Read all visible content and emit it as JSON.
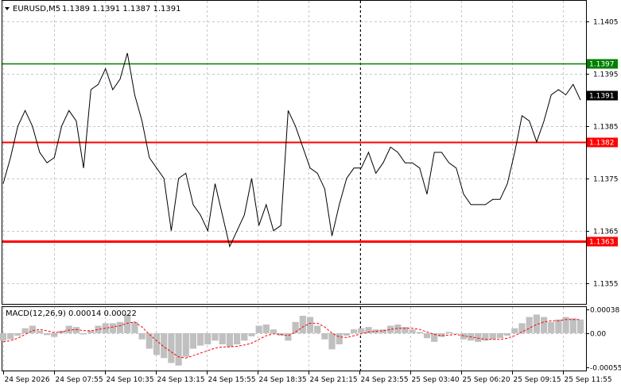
{
  "header": {
    "symbol_label": "EURUSD,M5",
    "ohlc": "1.1389 1.1391 1.1387 1.1391"
  },
  "indicator": {
    "label": "MACD(12,26,9)",
    "values": "0.00014 0.00022"
  },
  "colors": {
    "price_line": "#000000",
    "support_resistance": "#ff0000",
    "target_line": "#008000",
    "current_price_tag": "#000000",
    "macd_histogram": "#c0c0c0",
    "macd_signal": "#ff0000",
    "grid": "#c8c8c8"
  },
  "chart_data": [
    {
      "type": "line",
      "title": "EURUSD,M5",
      "x_tick_labels": [
        "24 Sep 2026",
        "24 Sep 07:55",
        "24 Sep 10:35",
        "24 Sep 13:15",
        "24 Sep 15:55",
        "24 Sep 18:35",
        "24 Sep 21:15",
        "24 Sep 23:55",
        "25 Sep 03:40",
        "25 Sep 06:20",
        "25 Sep 09:15",
        "25 Sep 11:55"
      ],
      "y_tick_labels": [
        "1.1405",
        "1.1395",
        "1.1385",
        "1.1375",
        "1.1365",
        "1.1355"
      ],
      "ylim": [
        1.1351,
        1.1409
      ],
      "y_ticks": [
        1.1405,
        1.1395,
        1.1385,
        1.1375,
        1.1365,
        1.1355
      ],
      "horizontal_lines": [
        {
          "label": "1.1397",
          "value": 1.1397,
          "color": "#008000"
        },
        {
          "label": "1.1382",
          "value": 1.1382,
          "color": "#ff0000"
        },
        {
          "label": "1.1363",
          "value": 1.1363,
          "color": "#ff0000"
        }
      ],
      "current_price": {
        "label": "1.1391",
        "value": 1.1391
      },
      "separator_at_index": 11.0,
      "grid": true,
      "series": [
        {
          "values": [
            1.1374,
            1.1379,
            1.1385,
            1.1388,
            1.1385,
            1.138,
            1.1378,
            1.1379,
            1.1385,
            1.1388,
            1.1386,
            1.1377,
            1.1392,
            1.1393,
            1.1396,
            1.1392,
            1.1394,
            1.1399,
            1.1391,
            1.1386,
            1.1379,
            1.1377,
            1.1375,
            1.1365,
            1.1375,
            1.1376,
            1.137,
            1.1368,
            1.1365,
            1.1374,
            1.1368,
            1.1362,
            1.1365,
            1.1368,
            1.1375,
            1.1366,
            1.137,
            1.1365,
            1.1366,
            1.1388,
            1.1385,
            1.1381,
            1.1377,
            1.1376,
            1.1373,
            1.1364,
            1.137,
            1.1375,
            1.1377,
            1.1377,
            1.138,
            1.1376,
            1.1378,
            1.1381,
            1.138,
            1.1378,
            1.1378,
            1.1377,
            1.1372,
            1.138,
            1.138,
            1.1378,
            1.1377,
            1.1372,
            1.137,
            1.137,
            1.137,
            1.1371,
            1.1371,
            1.1374,
            1.138,
            1.1387,
            1.1386,
            1.1382,
            1.1386,
            1.1391,
            1.1392,
            1.1391,
            1.1393,
            1.139
          ]
        }
      ]
    },
    {
      "type": "bar",
      "title": "MACD(12,26,9)",
      "y_tick_labels": [
        "0.00038",
        "0.00",
        "-0.00055"
      ],
      "ylim": [
        -0.0006,
        0.00042
      ],
      "y_ticks": [
        0.00038,
        0.0,
        -0.00055
      ],
      "series": [
        {
          "name": "MACD",
          "values": [
            -0.00012,
            -0.0001,
            -4e-05,
            8e-05,
            0.00012,
            4e-05,
            -3e-05,
            -6e-05,
            4e-05,
            0.00012,
            0.0001,
            -2e-05,
            4e-05,
            0.00012,
            0.00016,
            0.00016,
            0.00018,
            0.0003,
            0.00018,
            -0.0001,
            -0.00025,
            -0.00035,
            -0.0004,
            -0.00048,
            -0.00052,
            -0.00038,
            -0.00025,
            -0.0002,
            -0.00018,
            -0.00012,
            -0.00018,
            -0.00022,
            -0.00018,
            -0.00012,
            -5e-05,
            0.00012,
            0.00014,
            6e-05,
            -4e-05,
            -0.00012,
            0.00018,
            0.00028,
            0.00026,
            0.00012,
            -0.0001,
            -0.00026,
            -0.00018,
            -4e-05,
            6e-05,
            8e-05,
            0.0001,
            6e-05,
            6e-05,
            0.00012,
            0.00014,
            0.0001,
            6e-05,
            2e-05,
            -8e-05,
            -0.00014,
            -6e-05,
            2e-05,
            0.0,
            -0.0001,
            -0.00012,
            -0.00014,
            -0.00012,
            -0.0001,
            -8e-05,
            -4e-05,
            8e-05,
            0.00016,
            0.00026,
            0.0003,
            0.00026,
            0.00018,
            0.00022,
            0.00026,
            0.00024,
            0.00022
          ]
        },
        {
          "name": "Signal",
          "values": [
            -0.00014,
            -0.00012,
            -8e-05,
            -2e-05,
            4e-05,
            6e-05,
            4e-05,
            1e-05,
            2e-05,
            5e-05,
            6e-05,
            4e-05,
            4e-05,
            6e-05,
            8e-05,
            0.0001,
            0.00012,
            0.00016,
            0.00018,
            0.0001,
            -2e-05,
            -0.00012,
            -0.00022,
            -0.0003,
            -0.00038,
            -0.0004,
            -0.00036,
            -0.00032,
            -0.00028,
            -0.00024,
            -0.00022,
            -0.00022,
            -0.00021,
            -0.00019,
            -0.00016,
            -0.0001,
            -4e-05,
            -1e-05,
            -2e-05,
            -4e-05,
            2e-05,
            0.0001,
            0.00016,
            0.00016,
            0.0001,
            0.0,
            -6e-05,
            -7e-05,
            -4e-05,
            -1e-05,
            2e-05,
            3e-05,
            4e-05,
            6e-05,
            8e-05,
            8e-05,
            8e-05,
            6e-05,
            2e-05,
            -2e-05,
            -4e-05,
            -3e-05,
            -2e-05,
            -4e-05,
            -6e-05,
            -8e-05,
            -0.0001,
            -0.0001,
            -0.0001,
            -8e-05,
            -4e-05,
            2e-05,
            8e-05,
            0.00014,
            0.00018,
            0.0002,
            0.0002,
            0.00022,
            0.00022,
            0.00022
          ]
        }
      ]
    }
  ]
}
